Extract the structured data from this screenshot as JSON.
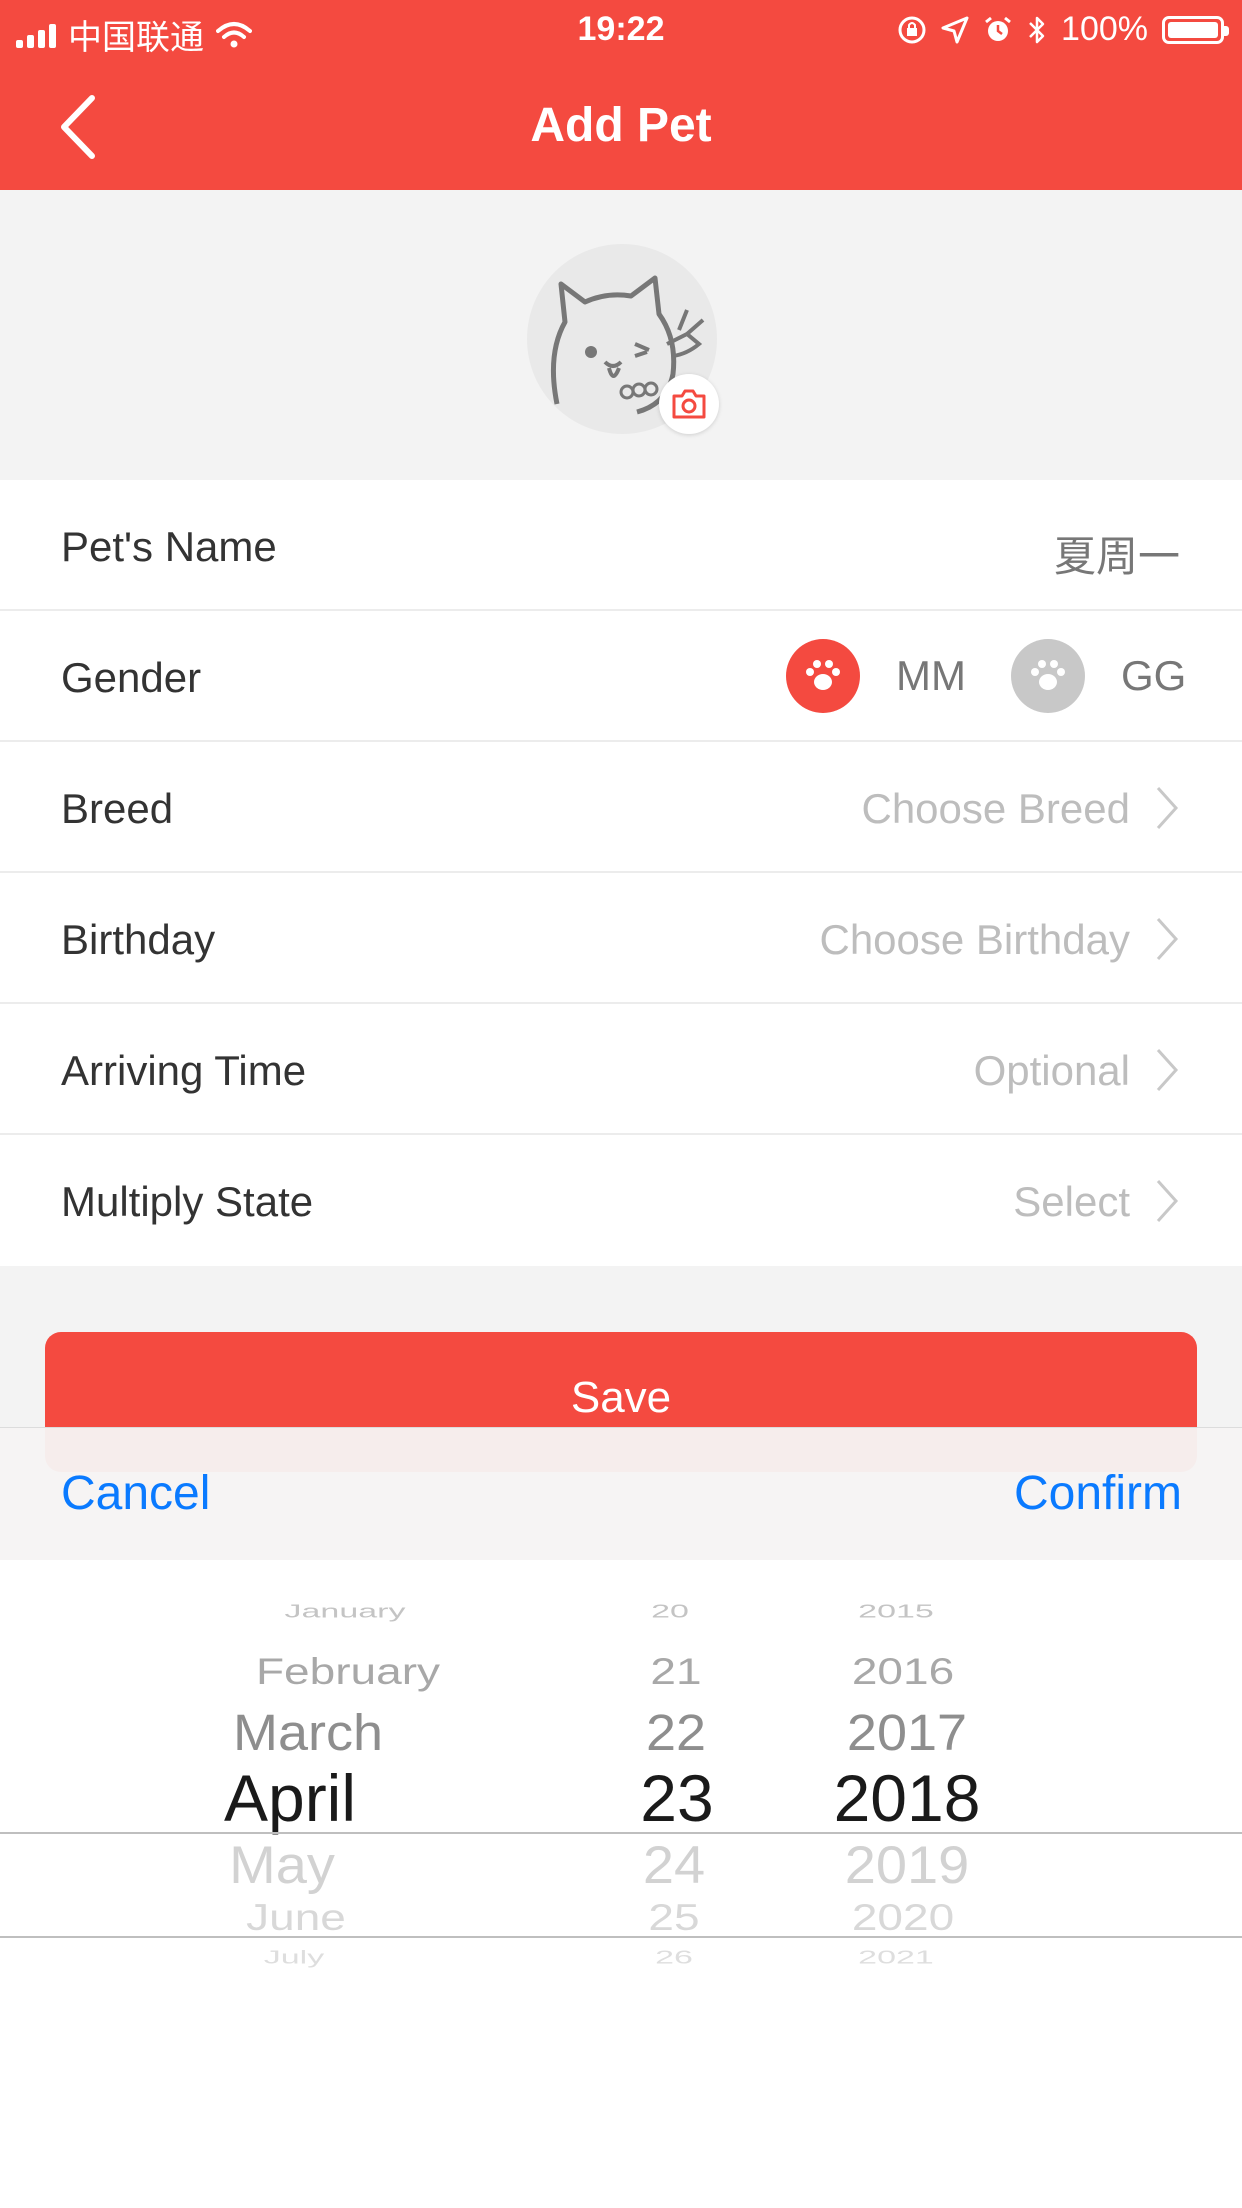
{
  "status_bar": {
    "carrier": "中国联通",
    "time": "19:22",
    "battery": "100%"
  },
  "nav": {
    "title": "Add Pet",
    "back_icon": "chevron-left-icon"
  },
  "avatar": {
    "icon": "cat-avatar-icon",
    "camera_icon": "camera-icon"
  },
  "form": {
    "name": {
      "label": "Pet's Name",
      "value": "夏周一"
    },
    "gender": {
      "label": "Gender",
      "options": [
        {
          "label": "MM",
          "selected": true
        },
        {
          "label": "GG",
          "selected": false
        }
      ]
    },
    "breed": {
      "label": "Breed",
      "placeholder": "Choose Breed"
    },
    "birthday": {
      "label": "Birthday",
      "placeholder": "Choose Birthday"
    },
    "arriving": {
      "label": "Arriving Time",
      "placeholder": "Optional"
    },
    "multiply": {
      "label": "Multiply State",
      "placeholder": "Select"
    }
  },
  "save_label": "Save",
  "picker": {
    "cancel_label": "Cancel",
    "confirm_label": "Confirm",
    "months": [
      "January",
      "February",
      "March",
      "April",
      "May",
      "June",
      "July"
    ],
    "days": [
      "20",
      "21",
      "22",
      "23",
      "24",
      "25",
      "26"
    ],
    "years": [
      "2015",
      "2016",
      "2017",
      "2018",
      "2019",
      "2020",
      "2021"
    ],
    "selected": {
      "month": "April",
      "day": "23",
      "year": "2018"
    }
  },
  "colors": {
    "accent": "#f44a40",
    "link": "#0a7aff",
    "gender_unselected": "#c8c8c8"
  }
}
